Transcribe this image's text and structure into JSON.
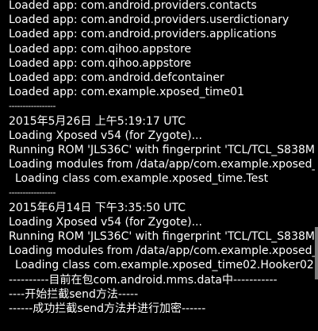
{
  "log": {
    "lines": [
      {
        "text": "Loaded app: com.android.providers.contacts",
        "indent": false
      },
      {
        "text": "Loaded app: com.android.providers.userdictionary",
        "indent": false
      },
      {
        "text": "Loaded app: com.android.providers.applications",
        "indent": false
      },
      {
        "text": "Loaded app: com.qihoo.appstore",
        "indent": false
      },
      {
        "text": "Loaded app: com.qihoo.appstore",
        "indent": false
      },
      {
        "text": "Loaded app: com.android.defcontainer",
        "indent": false
      },
      {
        "text": "Loaded app: com.example.xposed_time01",
        "indent": false
      },
      {
        "text": "-----------------",
        "indent": false,
        "sep": true
      },
      {
        "text": "2015年5月26日 上午5:19:17 UTC",
        "indent": false
      },
      {
        "text": "Loading Xposed v54 (for Zygote)...",
        "indent": false
      },
      {
        "text": "Running ROM 'JLS36C' with fingerprint 'TCL/TCL_S838M",
        "indent": false
      },
      {
        "text": "Loading modules from /data/app/com.example.xposed_",
        "indent": false
      },
      {
        "text": "Loading class com.example.xposed_time.Test",
        "indent": true
      },
      {
        "text": "-----------------",
        "indent": false,
        "sep": true
      },
      {
        "text": "2015年6月14日 下午3:35:50 UTC",
        "indent": false
      },
      {
        "text": "Loading Xposed v54 (for Zygote)...",
        "indent": false
      },
      {
        "text": "Running ROM 'JLS36C' with fingerprint 'TCL/TCL_S838M",
        "indent": false
      },
      {
        "text": "Loading modules from /data/app/com.example.xposed_",
        "indent": false
      },
      {
        "text": "Loading class com.example.xposed_time02.Hooker02",
        "indent": true
      },
      {
        "text": "----------目前在包com.android.mms.data中-----------",
        "indent": false
      },
      {
        "text": "----开始拦截send方法-----",
        "indent": false
      },
      {
        "text": "------成功拦截send方法并进行加密------",
        "indent": false
      }
    ]
  },
  "colors": {
    "background": "#000000",
    "text": "#ffffff",
    "scrollbar": "#7a7a7a"
  }
}
